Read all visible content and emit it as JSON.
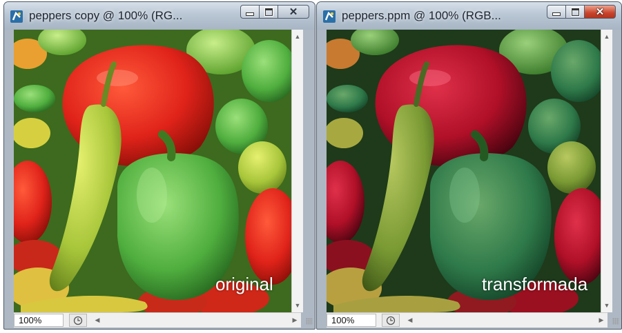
{
  "colors": {
    "frame": "#aeb8c4",
    "close_active": "#c9442b",
    "statusbar": "#f0f0f0"
  },
  "windows": [
    {
      "id": "left",
      "title": "peppers copy @ 100% (RG...",
      "zoom": "100%",
      "photo_label": "original",
      "icons": {
        "app": "photoshop-doc-icon",
        "minimize": "minimize-icon",
        "maximize": "maximize-icon",
        "close": "close-icon"
      }
    },
    {
      "id": "right",
      "title": "peppers.ppm @ 100% (RGB...",
      "zoom": "100%",
      "photo_label": "transformada",
      "icons": {
        "app": "photoshop-doc-icon",
        "minimize": "minimize-icon",
        "maximize": "maximize-icon",
        "close": "close-icon"
      }
    }
  ]
}
